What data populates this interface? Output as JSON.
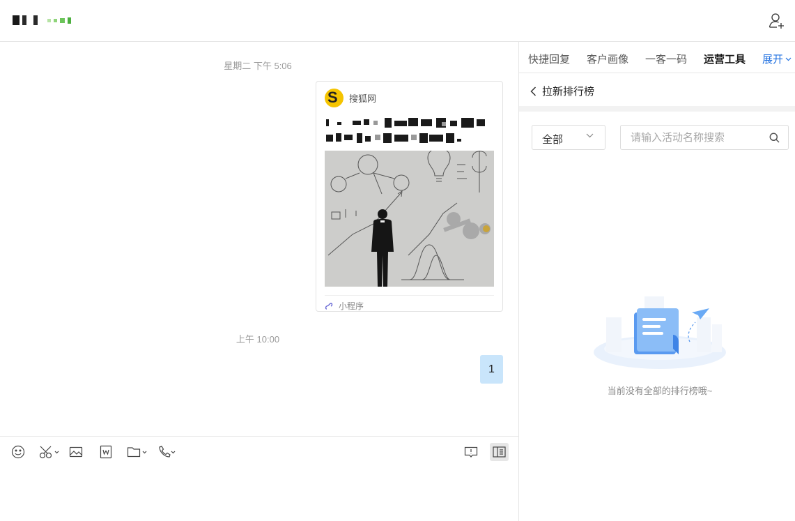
{
  "header": {
    "contact_name": "",
    "add_user_icon": "add-user-icon"
  },
  "chat": {
    "timestamps": [
      "星期二 下午 5:06",
      "上午 10:00"
    ],
    "card": {
      "source": "搜狐网",
      "logo_letter": "S",
      "footer_label": "小程序",
      "footer_icon": "mini-program-icon"
    },
    "message_text": "1"
  },
  "toolbar": {
    "icons": [
      "emoji-icon",
      "screenshot-scissors-icon",
      "image-icon",
      "word-file-icon",
      "folder-icon",
      "phone-call-icon",
      "feedback-icon",
      "sidebar-panel-icon"
    ]
  },
  "panel": {
    "tabs": [
      "快捷回复",
      "客户画像",
      "一客一码",
      "运营工具"
    ],
    "more_label": "展开",
    "active_tab": "运营工具",
    "back_label": "拉新排行榜",
    "filter": {
      "selected": "全部"
    },
    "search": {
      "placeholder": "请输入活动名称搜索"
    },
    "empty_text": "当前没有全部的排行榜哦~"
  },
  "colors": {
    "accent": "#1e6fe0",
    "bubble": "#c9e5fb",
    "sohu_yellow": "#f5c400"
  }
}
